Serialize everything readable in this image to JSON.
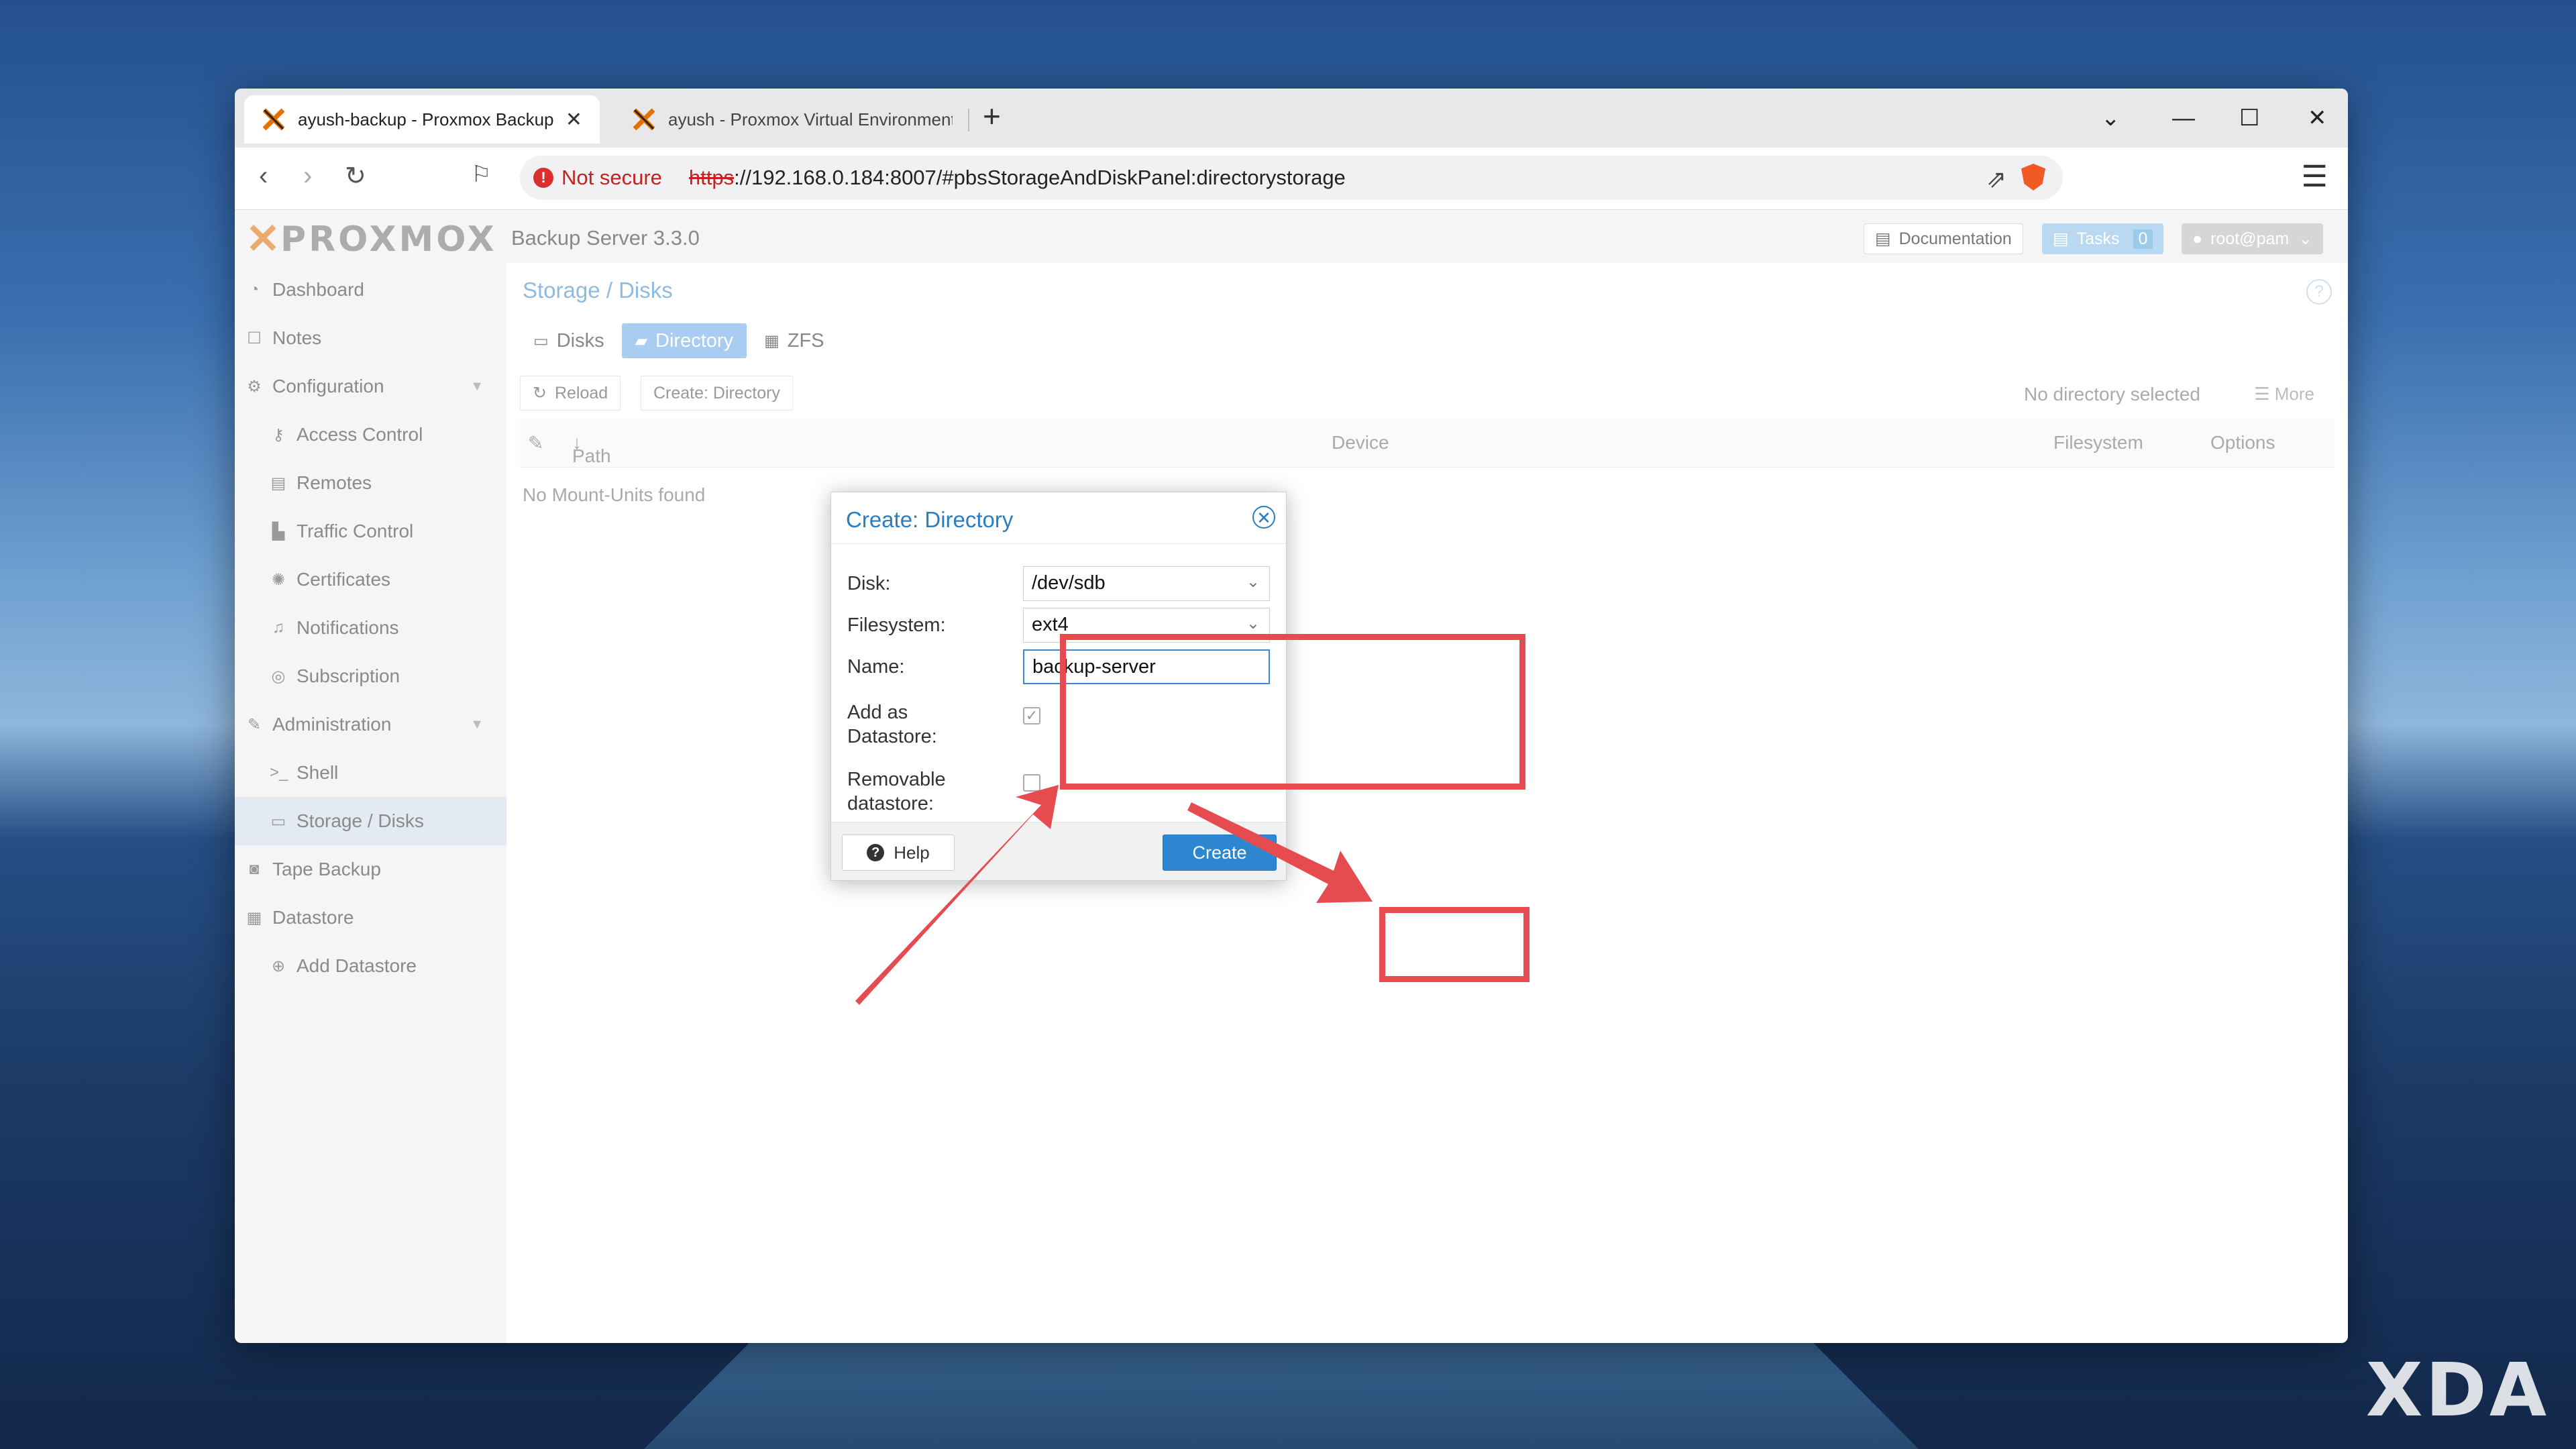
{
  "browser": {
    "tabs": [
      {
        "title": "ayush-backup - Proxmox Backup Server",
        "active": true
      },
      {
        "title": "ayush - Proxmox Virtual Environment",
        "active": false
      }
    ],
    "address": {
      "security_label": "Not secure",
      "protocol": "https",
      "url_rest": "://192.168.0.184:8007/#pbsStorageAndDiskPanel:directorystorage"
    }
  },
  "app": {
    "logo_text": "PROXMOX",
    "product": "Backup Server 3.3.0",
    "header": {
      "documentation": "Documentation",
      "tasks": "Tasks",
      "tasks_count": "0",
      "user": "root@pam"
    }
  },
  "sidebar": {
    "items": [
      {
        "label": "Dashboard",
        "icon": "dashboard-icon",
        "glyph": "◔",
        "level": 1
      },
      {
        "label": "Notes",
        "icon": "notes-icon",
        "glyph": "☐",
        "level": 1
      },
      {
        "label": "Configuration",
        "icon": "gears-icon",
        "glyph": "⚙",
        "level": 1,
        "expandable": true
      },
      {
        "label": "Access Control",
        "icon": "key-icon",
        "glyph": "⚷",
        "level": 2
      },
      {
        "label": "Remotes",
        "icon": "server-icon",
        "glyph": "▤",
        "level": 2
      },
      {
        "label": "Traffic Control",
        "icon": "chart-icon",
        "glyph": "▙",
        "level": 2
      },
      {
        "label": "Certificates",
        "icon": "certificate-icon",
        "glyph": "✺",
        "level": 2
      },
      {
        "label": "Notifications",
        "icon": "bell-icon",
        "glyph": "♫",
        "level": 2
      },
      {
        "label": "Subscription",
        "icon": "support-icon",
        "glyph": "◎",
        "level": 2
      },
      {
        "label": "Administration",
        "icon": "wrench-icon",
        "glyph": "✎",
        "level": 1,
        "expandable": true
      },
      {
        "label": "Shell",
        "icon": "terminal-icon",
        "glyph": ">_",
        "level": 2
      },
      {
        "label": "Storage / Disks",
        "icon": "hdd-icon",
        "glyph": "▭",
        "level": 2,
        "selected": true
      },
      {
        "label": "Tape Backup",
        "icon": "tape-icon",
        "glyph": "◙",
        "level": 1
      },
      {
        "label": "Datastore",
        "icon": "database-icon",
        "glyph": "▦",
        "level": 1
      },
      {
        "label": "Add Datastore",
        "icon": "plus-circle-icon",
        "glyph": "⊕",
        "level": 2
      }
    ]
  },
  "panel": {
    "title": "Storage / Disks",
    "tabs": [
      {
        "label": "Disks",
        "icon": "hdd-icon",
        "glyph": "▭",
        "active": false
      },
      {
        "label": "Directory",
        "icon": "folder-icon",
        "glyph": "▰",
        "active": true
      },
      {
        "label": "ZFS",
        "icon": "grid-icon",
        "glyph": "▦",
        "active": false
      }
    ],
    "toolbar": {
      "reload": "Reload",
      "create_directory": "Create: Directory",
      "selection_status": "No directory selected",
      "more": "More"
    },
    "columns": {
      "path": "Path",
      "device": "Device",
      "filesystem": "Filesystem",
      "options": "Options"
    },
    "empty_text": "No Mount-Units found"
  },
  "dialog": {
    "title": "Create: Directory",
    "fields": {
      "disk_label": "Disk:",
      "disk_value": "/dev/sdb",
      "filesystem_label": "Filesystem:",
      "filesystem_value": "ext4",
      "name_label": "Name:",
      "name_value": "backup-server",
      "add_datastore_label_1": "Add as",
      "add_datastore_label_2": "Datastore:",
      "add_datastore_checked": true,
      "removable_label_1": "Removable",
      "removable_label_2": "datastore:",
      "removable_checked": false
    },
    "buttons": {
      "help": "Help",
      "create": "Create"
    }
  },
  "watermark": "XDA",
  "colors": {
    "annotation_red": "#e54b4f",
    "primary_blue": "#2d86d0",
    "proxmox_orange": "#e57000"
  }
}
